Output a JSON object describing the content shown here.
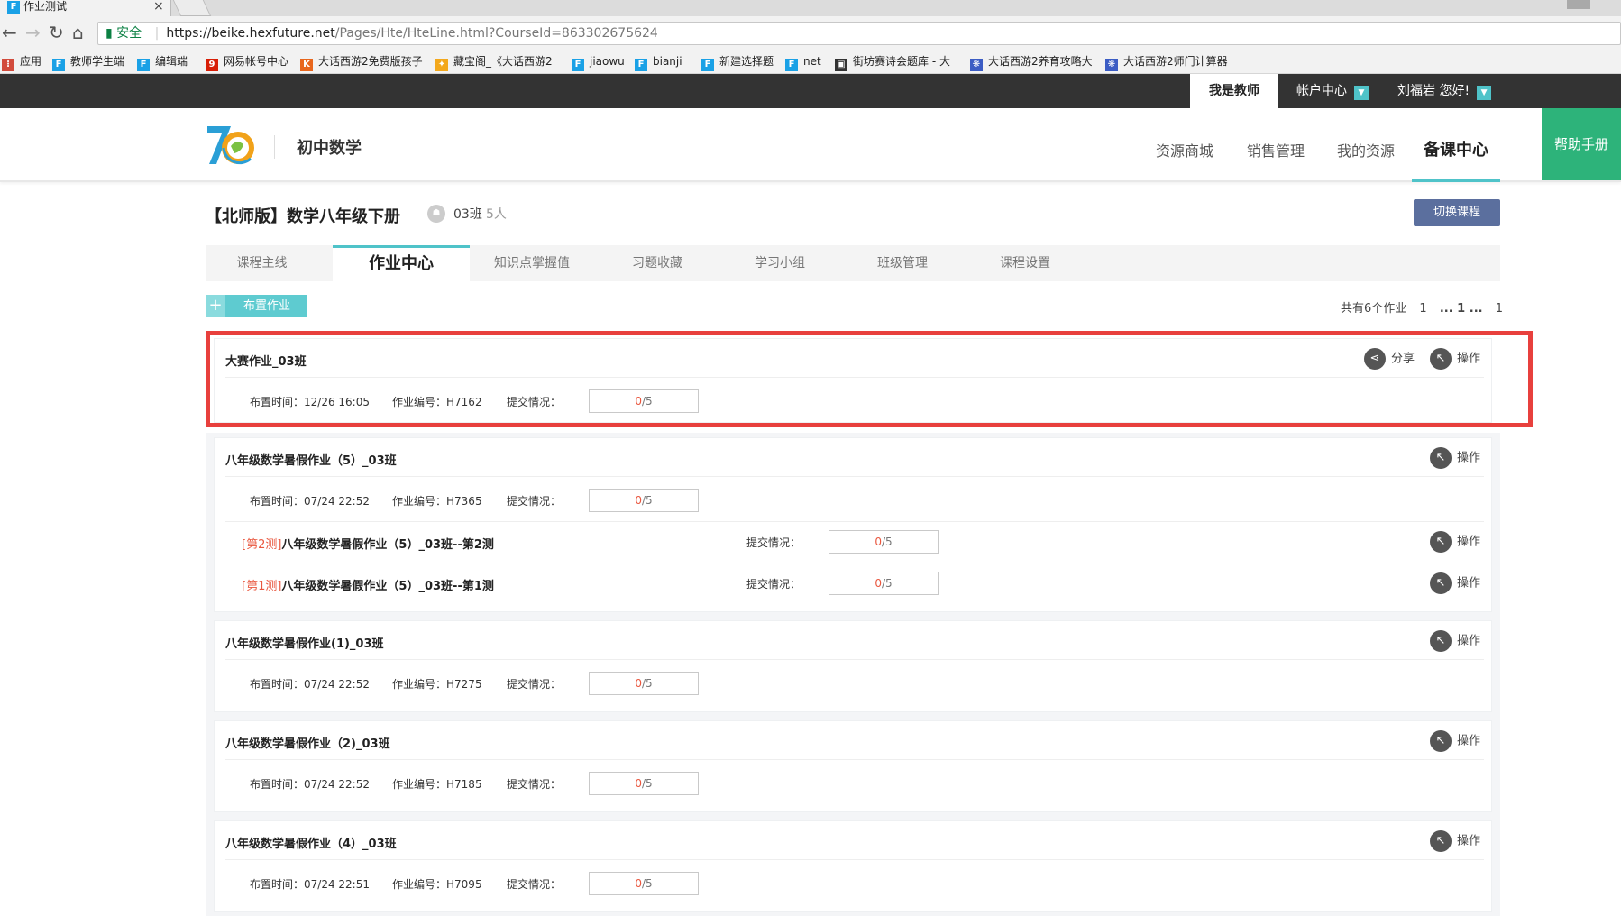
{
  "browser": {
    "tab_title": "作业测试",
    "tab_favicon": "F",
    "tab_close": "×",
    "secure_label": "安全",
    "url_host": "https://beike.hexfuture.net",
    "url_path": "/Pages/Hte/HteLine.html?CourseId=863302675624",
    "bookmarks": [
      {
        "label": "应用",
        "icon": "apps-icon",
        "color": "#d24b3c"
      },
      {
        "label": "教师学生端",
        "icon": "F",
        "color": "#1aa1e6"
      },
      {
        "label": "编辑端",
        "icon": "F",
        "color": "#1aa1e6"
      },
      {
        "label": "网易帐号中心",
        "icon": "9",
        "color": "#d81e06"
      },
      {
        "label": "大话西游2免费版孩子",
        "icon": "K",
        "color": "#e8661c"
      },
      {
        "label": "藏宝阁_《大话西游2",
        "icon": "✦",
        "color": "#f3a81c"
      },
      {
        "label": "jiaowu",
        "icon": "F",
        "color": "#1aa1e6"
      },
      {
        "label": "bianji",
        "icon": "F",
        "color": "#1aa1e6"
      },
      {
        "label": "新建选择题",
        "icon": "F",
        "color": "#1aa1e6"
      },
      {
        "label": "net",
        "icon": "F",
        "color": "#1aa1e6"
      },
      {
        "label": "街坊赛诗会题库 - 大",
        "icon": "▣",
        "color": "#333333"
      },
      {
        "label": "大话西游2养育攻略大",
        "icon": "❋",
        "color": "#3b5cc4"
      },
      {
        "label": "大话西游2师门计算器",
        "icon": "❋",
        "color": "#3b5cc4"
      }
    ]
  },
  "topbar": {
    "teacher": "我是教师",
    "account": "帐户中心",
    "greeting": "刘福岩 您好!"
  },
  "header": {
    "course": "初中数学",
    "nav": [
      "资源商城",
      "销售管理",
      "我的资源",
      "备课中心"
    ],
    "help": "帮助手册"
  },
  "course_line": {
    "book": "【北师版】数学八年级下册",
    "class_name": "03班",
    "class_size": "5人",
    "switch": "切换课程"
  },
  "tabs": [
    "课程主线",
    "作业中心",
    "知识点掌握值",
    "习题收藏",
    "学习小组",
    "班级管理",
    "课程设置"
  ],
  "assign_label": "布置作业",
  "pager": {
    "total": "共有6个作业",
    "first": "1",
    "current": "... 1 ...",
    "last": "1"
  },
  "labels": {
    "time": "布置时间：",
    "code": "作业编号：",
    "submit": "提交情况：",
    "share": "分享",
    "operate": "操作"
  },
  "homeworks": [
    {
      "title": "大赛作业_03班",
      "time": "12/26 16:05",
      "code": "H7162",
      "done": "0",
      "total": "/5"
    },
    {
      "title": "八年级数学暑假作业（5）_03班",
      "time": "07/24 22:52",
      "code": "H7365",
      "done": "0",
      "total": "/5",
      "subs": [
        {
          "tag": "[第2测]",
          "title": "八年级数学暑假作业（5）_03班--第2测",
          "done": "0",
          "total": "/5"
        },
        {
          "tag": "[第1测]",
          "title": "八年级数学暑假作业（5）_03班--第1测",
          "done": "0",
          "total": "/5"
        }
      ]
    },
    {
      "title": "八年级数学暑假作业(1)_03班",
      "time": "07/24 22:52",
      "code": "H7275",
      "done": "0",
      "total": "/5"
    },
    {
      "title": "八年级数学暑假作业（2)_03班",
      "time": "07/24 22:52",
      "code": "H7185",
      "done": "0",
      "total": "/5"
    },
    {
      "title": "八年级数学暑假作业（4）_03班",
      "time": "07/24 22:51",
      "code": "H7095",
      "done": "0",
      "total": "/5"
    }
  ],
  "colors": {
    "accent": "#4fc3c9",
    "help_green": "#2db37a",
    "highlight_red": "#e8403d",
    "done_orange": "#e9573f"
  }
}
